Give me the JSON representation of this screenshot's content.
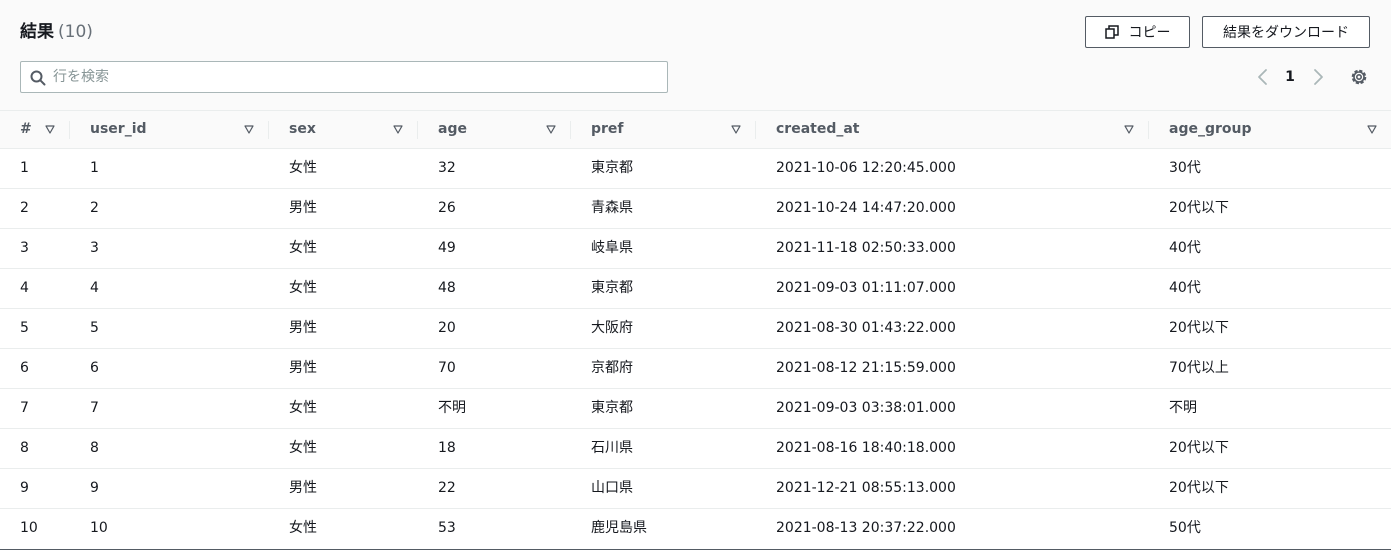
{
  "header": {
    "title": "結果",
    "count": "(10)",
    "copy_label": "コピー",
    "download_label": "結果をダウンロード"
  },
  "search": {
    "placeholder": "行を検索",
    "value": ""
  },
  "pagination": {
    "current_page": "1"
  },
  "icons": [
    "copy-icon",
    "search-icon",
    "chevron-left-icon",
    "chevron-right-icon",
    "gear-icon",
    "sort-down-icon"
  ],
  "table": {
    "columns": [
      "#",
      "user_id",
      "sex",
      "age",
      "pref",
      "created_at",
      "age_group"
    ],
    "rows": [
      [
        "1",
        "1",
        "女性",
        "32",
        "東京都",
        "2021-10-06 12:20:45.000",
        "30代"
      ],
      [
        "2",
        "2",
        "男性",
        "26",
        "青森県",
        "2021-10-24 14:47:20.000",
        "20代以下"
      ],
      [
        "3",
        "3",
        "女性",
        "49",
        "岐阜県",
        "2021-11-18 02:50:33.000",
        "40代"
      ],
      [
        "4",
        "4",
        "女性",
        "48",
        "東京都",
        "2021-09-03 01:11:07.000",
        "40代"
      ],
      [
        "5",
        "5",
        "男性",
        "20",
        "大阪府",
        "2021-08-30 01:43:22.000",
        "20代以下"
      ],
      [
        "6",
        "6",
        "男性",
        "70",
        "京都府",
        "2021-08-12 21:15:59.000",
        "70代以上"
      ],
      [
        "7",
        "7",
        "女性",
        "不明",
        "東京都",
        "2021-09-03 03:38:01.000",
        "不明"
      ],
      [
        "8",
        "8",
        "女性",
        "18",
        "石川県",
        "2021-08-16 18:40:18.000",
        "20代以下"
      ],
      [
        "9",
        "9",
        "男性",
        "22",
        "山口県",
        "2021-12-21 08:55:13.000",
        "20代以下"
      ],
      [
        "10",
        "10",
        "女性",
        "53",
        "鹿児島県",
        "2021-08-13 20:37:22.000",
        "50代"
      ]
    ]
  },
  "colors": {
    "text": "#16191f",
    "muted": "#687078",
    "header_text": "#545b64",
    "border": "#eaeded",
    "header_bg": "#fafafa"
  }
}
